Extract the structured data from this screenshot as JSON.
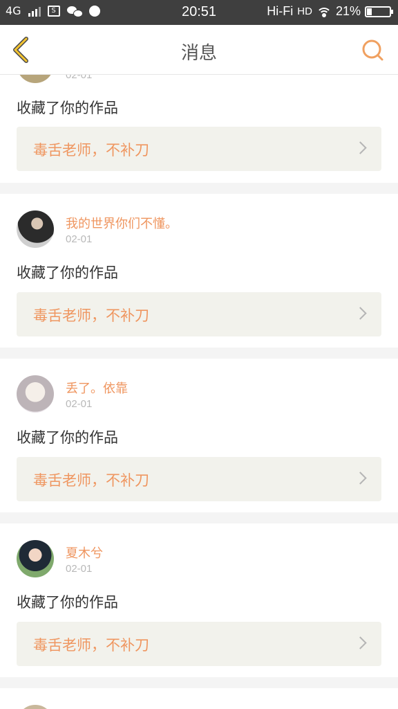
{
  "status_bar": {
    "network": "4G",
    "time": "20:51",
    "hifi": "Hi-Fi",
    "hd": "HD",
    "battery_percent": "21%",
    "battery_level": 0.21
  },
  "header": {
    "title": "消息",
    "accent_color": "#f0a060"
  },
  "messages": [
    {
      "user": "",
      "date": "02-01",
      "action": "收藏了你的作品",
      "work": "毒舌老师，不补刀"
    },
    {
      "user": "我的世界你们不懂。",
      "date": "02-01",
      "action": "收藏了你的作品",
      "work": "毒舌老师，不补刀"
    },
    {
      "user": "丢了。依靠",
      "date": "02-01",
      "action": "收藏了你的作品",
      "work": "毒舌老师，不补刀"
    },
    {
      "user": "夏木兮",
      "date": "02-01",
      "action": "收藏了你的作品",
      "work": "毒舌老师，不补刀"
    }
  ]
}
